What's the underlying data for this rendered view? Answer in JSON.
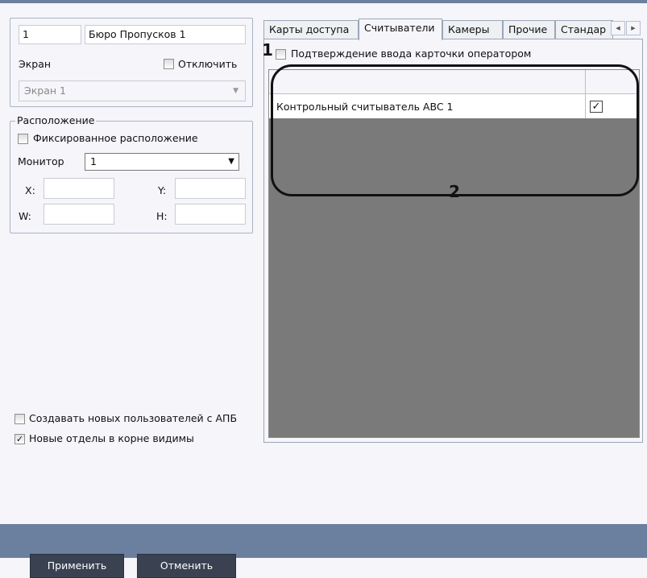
{
  "object": {
    "id": "1",
    "name": "Бюро Пропусков 1"
  },
  "screen": {
    "label": "Экран",
    "disable_label": "Отключить",
    "value": "Экран 1"
  },
  "location": {
    "title": "Расположение",
    "fixed_label": "Фиксированное расположение",
    "monitor_label": "Монитор",
    "monitor_value": "1",
    "x_label": "X:",
    "y_label": "Y:",
    "w_label": "W:",
    "h_label": "H:"
  },
  "options": {
    "create_users_label": "Создавать новых пользователей с АПБ",
    "create_users_checked": false,
    "new_depts_label": "Новые отделы в корне видимы",
    "new_depts_checked": true
  },
  "tabs": [
    "Карты доступа",
    "Считыватели",
    "Камеры",
    "Прочие",
    "Стандар"
  ],
  "active_tab": "Считыватели",
  "readers": {
    "confirm_label": "Подтверждение ввода карточки оператором",
    "rows": [
      {
        "name": "Контрольный считыватель ABC 1",
        "checked": true
      }
    ]
  },
  "annotations": {
    "n1": "1",
    "n2": "2"
  },
  "buttons": {
    "apply": "Применить",
    "cancel": "Отменить"
  },
  "colors": {
    "accent": "#6b7f9e",
    "button": "#3a4252",
    "grid_bg": "#7a7a7a"
  }
}
